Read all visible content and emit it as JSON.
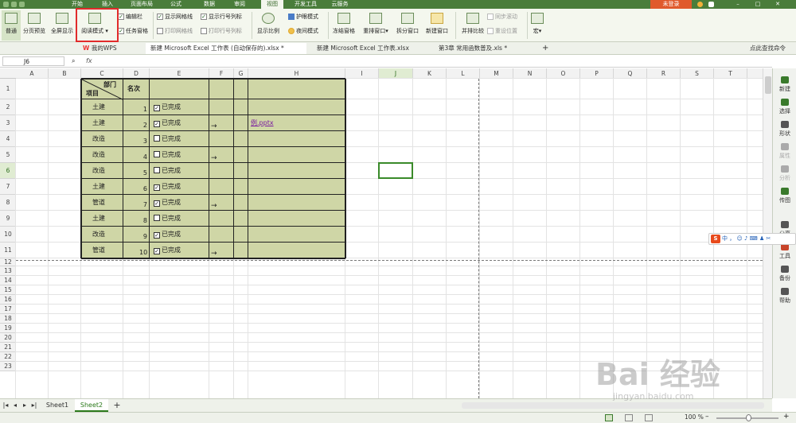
{
  "menu": {
    "items": [
      "开始",
      "插入",
      "页面布局",
      "公式",
      "数据",
      "审阅",
      "视图",
      "开发工具",
      "云服务"
    ],
    "active": "视图",
    "login": "未登录"
  },
  "ribbon": {
    "normal": "普通",
    "page_break": "分页预览",
    "fullscreen": "全屏显示",
    "reading_mode": "阅读模式",
    "edit_bar": "编辑栏",
    "task_pane": "任务窗格",
    "show_gridlines": "显示网格线",
    "print_gridlines": "打印网格线",
    "show_headings": "显示行号列标",
    "print_headings": "打印行号列标",
    "zoom": "显示比例",
    "eye_mode": "护眼模式",
    "night_mode": "夜间模式",
    "freeze": "冻结窗格",
    "rearrange": "重排窗口",
    "split": "拆分窗口",
    "new_window": "新建窗口",
    "side_by_side": "并排比较",
    "sync_scroll": "同步滚动",
    "reset_position": "重设位置",
    "macro": "宏"
  },
  "tabs": {
    "my_wps": "我的WPS",
    "t1": "新建 Microsoft Excel 工作表 (自动保存的).xlsx *",
    "t2": "新建 Microsoft Excel 工作表.xlsx",
    "t3": "第3章 常用函数普及.xls *",
    "help": "点此查找命令"
  },
  "formula": {
    "cell_ref": "J6",
    "fx": "fx",
    "content": ""
  },
  "columns": [
    "A",
    "B",
    "C",
    "D",
    "E",
    "F",
    "G",
    "H",
    "I",
    "J",
    "K",
    "L",
    "M",
    "N",
    "O",
    "P",
    "Q",
    "R",
    "S",
    "T"
  ],
  "rows": [
    "1",
    "2",
    "3",
    "4",
    "5",
    "6",
    "7",
    "8",
    "9",
    "10",
    "11",
    "12",
    "13",
    "14",
    "15",
    "16",
    "17",
    "18",
    "19",
    "20",
    "21",
    "22",
    "23"
  ],
  "table": {
    "header_dept": "部门",
    "header_item": "项目",
    "header_rank": "名次",
    "rows": [
      {
        "dept": "土建",
        "rank": "1",
        "checked": "true",
        "status": "已完成",
        "arrow": "",
        "link": ""
      },
      {
        "dept": "土建",
        "rank": "2",
        "checked": "true",
        "status": "已完成",
        "arrow": "→",
        "link": "例.pptx"
      },
      {
        "dept": "改造",
        "rank": "3",
        "checked": "false",
        "status": "已完成",
        "arrow": "",
        "link": ""
      },
      {
        "dept": "改造",
        "rank": "4",
        "checked": "false",
        "status": "已完成",
        "arrow": "→",
        "link": ""
      },
      {
        "dept": "改造",
        "rank": "5",
        "checked": "false",
        "status": "已完成",
        "arrow": "",
        "link": ""
      },
      {
        "dept": "土建",
        "rank": "6",
        "checked": "true",
        "status": "已完成",
        "arrow": "",
        "link": ""
      },
      {
        "dept": "管道",
        "rank": "7",
        "checked": "true",
        "status": "已完成",
        "arrow": "→",
        "link": ""
      },
      {
        "dept": "土建",
        "rank": "8",
        "checked": "false",
        "status": "已完成",
        "arrow": "",
        "link": ""
      },
      {
        "dept": "改造",
        "rank": "9",
        "checked": "true",
        "status": "已完成",
        "arrow": "",
        "link": ""
      },
      {
        "dept": "管道",
        "rank": "10",
        "checked": "true",
        "status": "已完成",
        "arrow": "→",
        "link": ""
      }
    ]
  },
  "right_panel": [
    "新建",
    "选择",
    "形状",
    "属性",
    "分析",
    "传图",
    "分享",
    "工具",
    "备份",
    "帮助"
  ],
  "sheets": [
    "Sheet1",
    "Sheet2"
  ],
  "active_sheet": "Sheet2",
  "status": {
    "zoom": "100 %"
  },
  "ime": {
    "label": "中 ， ☺ ♪ ⌨ ♟ ✂"
  },
  "watermark": {
    "text": "Bai 经验",
    "sub": "jingyan.baidu.com"
  }
}
